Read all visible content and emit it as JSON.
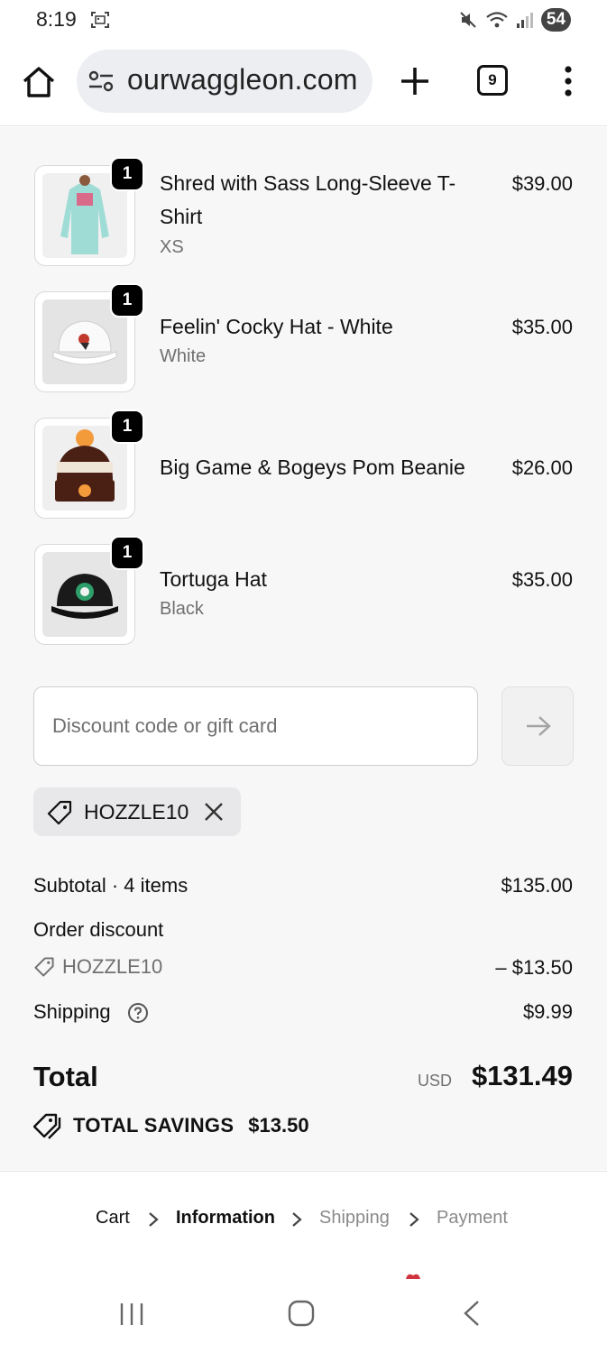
{
  "status_bar": {
    "time": "8:19",
    "battery": "54"
  },
  "browser": {
    "url": "ourwaggleon.com",
    "tab_count": "9"
  },
  "cart_items": [
    {
      "name": "Shred with Sass Long-Sleeve T-Shirt",
      "variant": "XS",
      "price": "$39.00",
      "quantity": "1",
      "image": "mint long-sleeve shirt"
    },
    {
      "name": "Feelin' Cocky Hat - White",
      "variant": "White",
      "price": "$35.00",
      "quantity": "1",
      "image": "white trucker hat with rooster"
    },
    {
      "name": "Big Game & Bogeys Pom Beanie",
      "variant": "",
      "price": "$26.00",
      "quantity": "1",
      "image": "brown pom beanie"
    },
    {
      "name": "Tortuga Hat",
      "variant": "Black",
      "price": "$35.00",
      "quantity": "1",
      "image": "black hat with turtle patch"
    }
  ],
  "discount": {
    "placeholder": "Discount code or gift card",
    "applied_code": "HOZZLE10"
  },
  "summary": {
    "subtotal_label": "Subtotal · 4 items",
    "subtotal_value": "$135.00",
    "order_discount_label": "Order discount",
    "discount_code": "HOZZLE10",
    "discount_value": "– $13.50",
    "shipping_label": "Shipping",
    "shipping_value": "$9.99",
    "total_label": "Total",
    "currency": "USD",
    "total_value": "$131.49",
    "savings_label": "TOTAL SAVINGS",
    "savings_value": "$13.50"
  },
  "breadcrumb": {
    "cart": "Cart",
    "information": "Information",
    "shipping": "Shipping",
    "payment": "Payment"
  },
  "colors": {
    "page_bg": "#f7f7f8",
    "text": "#111111",
    "muted": "#707070",
    "badge": "#000000"
  }
}
